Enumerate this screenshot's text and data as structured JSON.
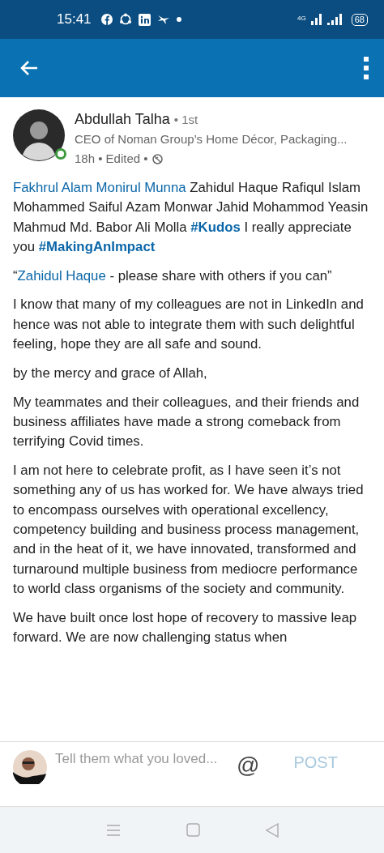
{
  "status_bar": {
    "time": "15:41",
    "battery": "68",
    "network": "4G"
  },
  "post": {
    "author": "Abdullah Talha",
    "degree": "• 1st",
    "headline": "CEO of Noman Group’s Home Décor, Packaging...",
    "meta": "18h • Edited •",
    "online": true,
    "paragraphs": [
      [
        {
          "kind": "mention",
          "text": "Fakhrul Alam Monirul Munna"
        },
        {
          "kind": "plain",
          "text": " Zahidul Haque Rafiqul Islam Mohammed Saiful Azam Monwar Jahid Mohammod Yeasin Mahmud Md. Babor Ali Molla "
        },
        {
          "kind": "hashtag",
          "text": "#Kudos"
        },
        {
          "kind": "plain",
          "text": " I really appreciate you "
        },
        {
          "kind": "hashtag",
          "text": "#MakingAnImpact"
        }
      ],
      [
        {
          "kind": "plain",
          "text": "“"
        },
        {
          "kind": "mention",
          "text": "Zahidul Haque"
        },
        {
          "kind": "plain",
          "text": " - please share with others if you can”"
        }
      ],
      [
        {
          "kind": "plain",
          "text": "I know that many of my colleagues are not in LinkedIn and hence was not able to integrate them with such delightful feeling, hope they are all safe and sound."
        }
      ],
      [
        {
          "kind": "plain",
          "text": "by the mercy and grace of Allah,"
        }
      ],
      [
        {
          "kind": "plain",
          "text": "My teammates and their colleagues, and their friends and business affiliates have made a strong comeback from terrifying Covid times."
        }
      ],
      [
        {
          "kind": "plain",
          "text": "I am not here to celebrate profit, as I have seen it’s not something any of us has worked for. We have always tried to encompass ourselves with operational excellency, competency building and business process management, and in the heat of it, we have innovated, transformed and turnaround multiple business from mediocre performance to world class organisms of the society and community."
        }
      ],
      [
        {
          "kind": "plain",
          "text": "We have built once lost hope of recovery to massive leap forward. We are now challenging status when"
        }
      ]
    ]
  },
  "comment_bar": {
    "placeholder": "Tell them what you loved...",
    "at_symbol": "@",
    "post_button": "POST"
  }
}
